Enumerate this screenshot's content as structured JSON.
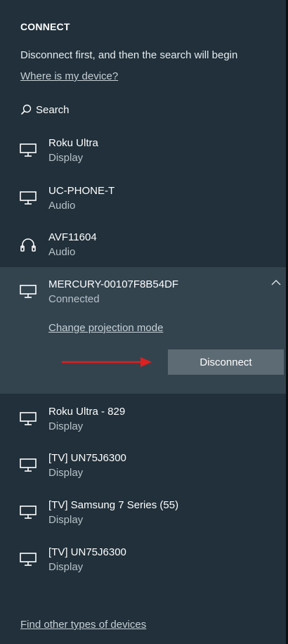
{
  "panel": {
    "title": "CONNECT",
    "info": "Disconnect first, and then the search will begin",
    "where_link": "Where is my device?",
    "search_label": "Search",
    "find_other": "Find other types of devices"
  },
  "devices": [
    {
      "name": "Roku Ultra",
      "type": "Display",
      "icon": "monitor-icon"
    },
    {
      "name": "UC-PHONE-T",
      "type": "Audio",
      "icon": "monitor-icon"
    },
    {
      "name": "AVF11604",
      "type": "Audio",
      "icon": "headphones-icon"
    },
    {
      "name": "MERCURY-00107F8B54DF",
      "type": "Connected",
      "icon": "monitor-icon"
    },
    {
      "name": "Roku Ultra - 829",
      "type": "Display",
      "icon": "monitor-icon"
    },
    {
      "name": "[TV] UN75J6300",
      "type": "Display",
      "icon": "monitor-icon"
    },
    {
      "name": "[TV] Samsung 7 Series (55)",
      "type": "Display",
      "icon": "monitor-icon"
    },
    {
      "name": "[TV] UN75J6300",
      "type": "Display",
      "icon": "monitor-icon"
    }
  ],
  "selected_device": {
    "change_mode_link": "Change projection mode",
    "disconnect_label": "Disconnect"
  },
  "colors": {
    "background": "#21303a",
    "selected_row": "#33444f",
    "button": "#5d6b74",
    "arrow": "#e02020"
  }
}
